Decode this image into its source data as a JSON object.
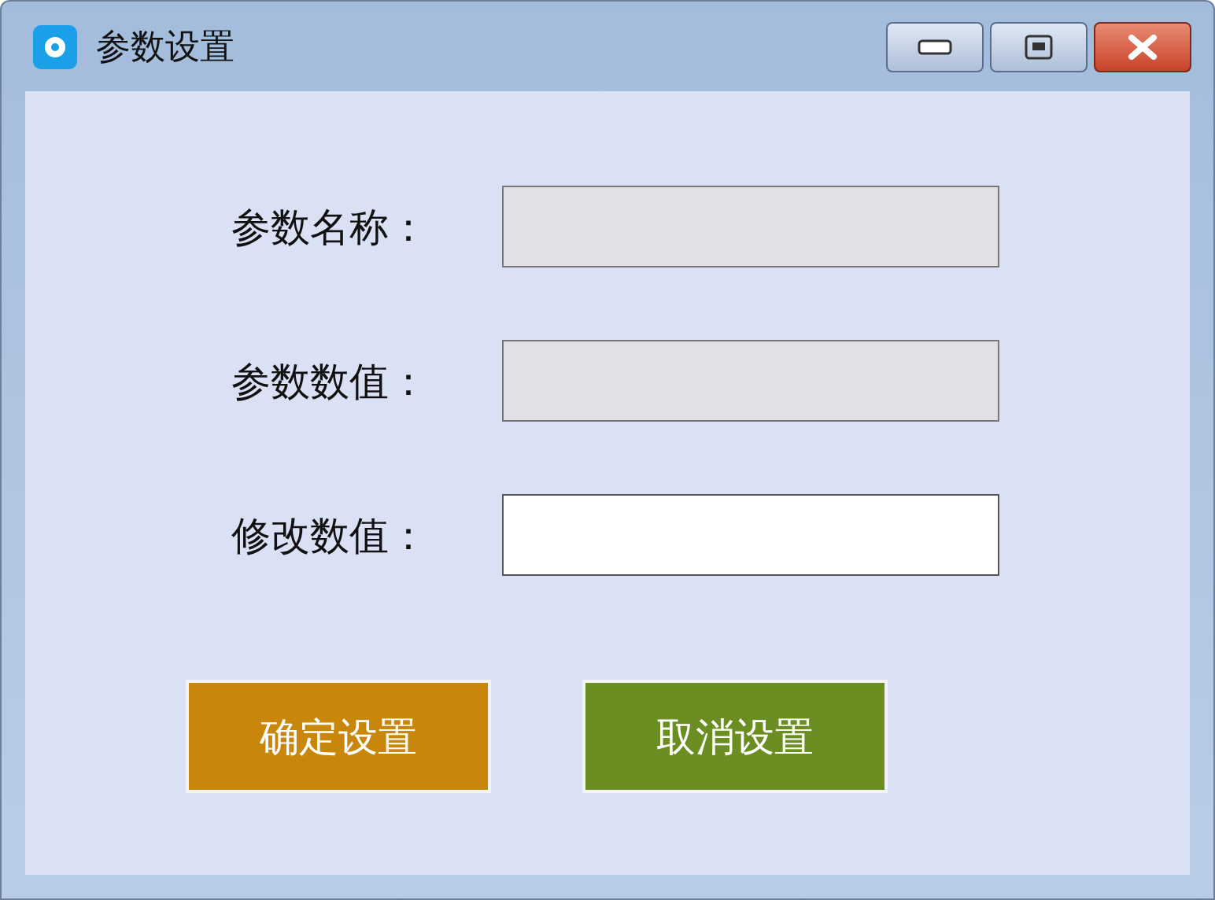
{
  "window": {
    "title": "参数设置"
  },
  "fields": [
    {
      "label": "参数名称：",
      "readonly": true
    },
    {
      "label": "参数数值：",
      "readonly": true
    },
    {
      "label": "修改数值：",
      "readonly": false
    }
  ],
  "buttons": [
    {
      "label": "确定设置",
      "color": "#c8860a"
    },
    {
      "label": "取消设置",
      "color": "#6b8e23"
    }
  ]
}
